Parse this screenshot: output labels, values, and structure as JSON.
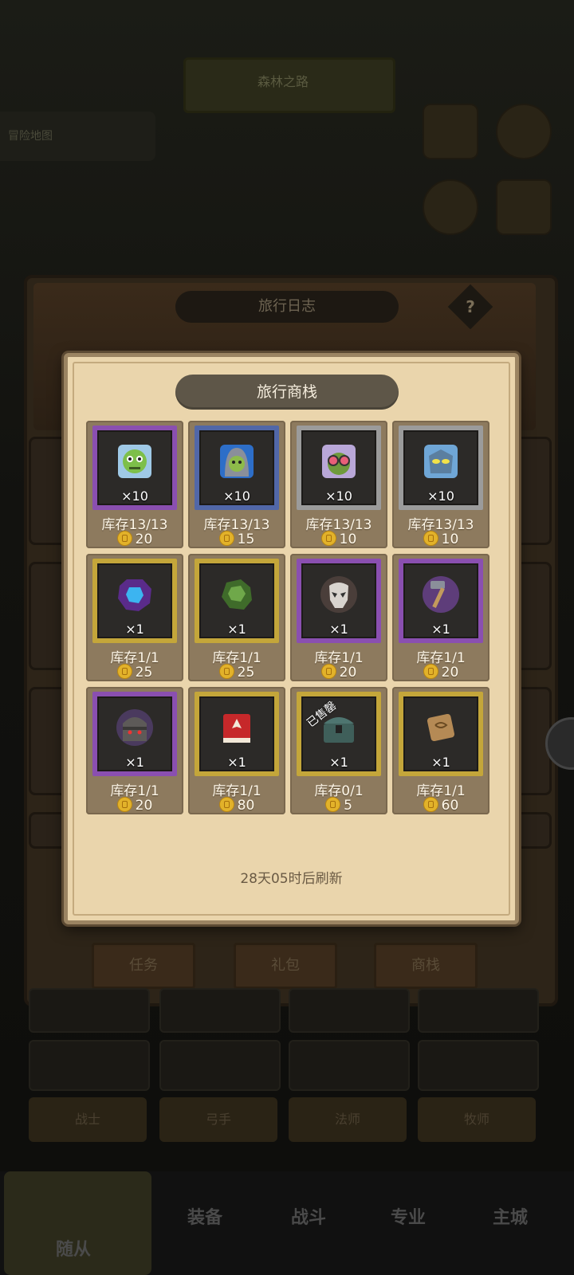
{
  "background": {
    "top_label": "森林之路",
    "left_pill": "冒险地图",
    "banner_title": "旅行日志",
    "help_symbol": "?",
    "tabs": [
      "任务",
      "礼包",
      "商栈"
    ],
    "class_labels": [
      "战士",
      "弓手",
      "法师",
      "牧师"
    ],
    "nav": [
      "随从",
      "装备",
      "战斗",
      "专业",
      "主城"
    ]
  },
  "shop": {
    "title": "旅行商栈",
    "refresh_text": "28天05时后刷新",
    "items": [
      {
        "icon": "zombie-icon",
        "rarity": "purple",
        "qty": "×10",
        "stock": "库存13/13",
        "price": "20"
      },
      {
        "icon": "hooded-zombie-icon",
        "rarity": "blue",
        "qty": "×10",
        "stock": "库存13/13",
        "price": "15"
      },
      {
        "icon": "goggles-goblin-icon",
        "rarity": "gray",
        "qty": "×10",
        "stock": "库存13/13",
        "price": "10"
      },
      {
        "icon": "robot-mask-icon",
        "rarity": "gray",
        "qty": "×10",
        "stock": "库存13/13",
        "price": "10"
      },
      {
        "icon": "purple-gem-icon",
        "rarity": "gold",
        "qty": "×1",
        "stock": "库存1/1",
        "price": "25"
      },
      {
        "icon": "green-ore-icon",
        "rarity": "gold",
        "qty": "×1",
        "stock": "库存1/1",
        "price": "25"
      },
      {
        "icon": "skull-mask-icon",
        "rarity": "purple",
        "qty": "×1",
        "stock": "库存1/1",
        "price": "20"
      },
      {
        "icon": "hammer-icon",
        "rarity": "purple",
        "qty": "×1",
        "stock": "库存1/1",
        "price": "20"
      },
      {
        "icon": "iron-helmet-icon",
        "rarity": "purple",
        "qty": "×1",
        "stock": "库存1/1",
        "price": "20"
      },
      {
        "icon": "red-book-icon",
        "rarity": "gold",
        "qty": "×1",
        "stock": "库存1/1",
        "price": "80"
      },
      {
        "icon": "treasure-chest-icon",
        "rarity": "gold",
        "qty": "×1",
        "stock": "库存0/1",
        "price": "5",
        "sold": "已售罄"
      },
      {
        "icon": "scroll-icon",
        "rarity": "gold",
        "qty": "×1",
        "stock": "库存1/1",
        "price": "60"
      }
    ]
  }
}
